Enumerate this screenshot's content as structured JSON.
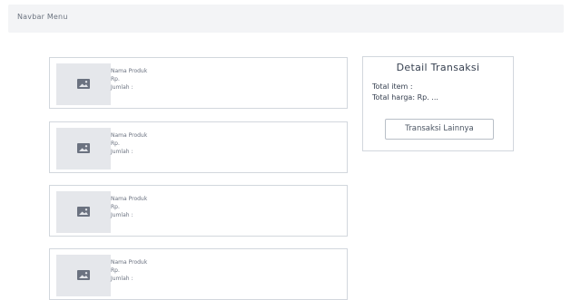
{
  "navbar": {
    "title": "Navbar Menu"
  },
  "products": [
    {
      "name": "Nama Produk",
      "price": "Rp.",
      "qty": "Jumlah :"
    },
    {
      "name": "Nama Produk",
      "price": "Rp.",
      "qty": "Jumlah :"
    },
    {
      "name": "Nama Produk",
      "price": "Rp.",
      "qty": "Jumlah :"
    },
    {
      "name": "Nama Produk",
      "price": "Rp.",
      "qty": "Jumlah :"
    }
  ],
  "detail": {
    "title": "Detail Transaksi",
    "total_item": "Total item :",
    "total_price": "Total harga: Rp. ...",
    "button_label": "Transaksi Lainnya"
  },
  "icons": {
    "product_thumbnail": "image-icon"
  },
  "colors": {
    "navbar_bg": "#f3f4f6",
    "card_border": "#d2d7dd",
    "thumbnail_bg": "#e5e7eb",
    "text": "#374151"
  }
}
